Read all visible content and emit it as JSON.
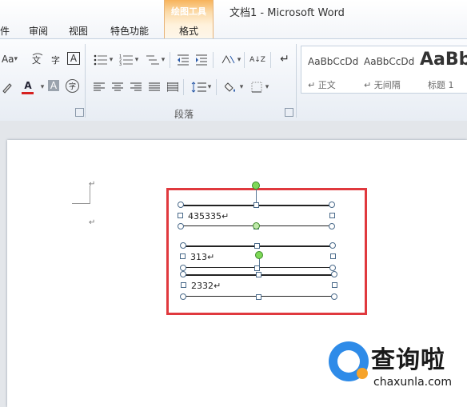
{
  "window": {
    "title": "文档1  -  Microsoft Word"
  },
  "tabs": {
    "file_partial": "件",
    "review": "审阅",
    "view": "视图",
    "special": "特色功能",
    "contextual_group": "绘图工具",
    "format": "格式"
  },
  "ribbon": {
    "font_partial": {
      "change_case_icon": "Aa",
      "font_color_letter": "A",
      "shade_letter": "A",
      "border_letter": "A"
    },
    "paragraph": {
      "group_label": "段落",
      "sort_label": "A↓Z"
    },
    "styles": {
      "items": [
        {
          "sample": "AaBbCcDd",
          "name": "↵ 正文"
        },
        {
          "sample": "AaBbCcDd",
          "name": "↵ 无间隔"
        },
        {
          "sample": "AaBb",
          "name": "标题 1"
        }
      ]
    },
    "colors": {
      "font_color_bar": "#d62020",
      "contextual_tab": "#f7b35a"
    }
  },
  "document": {
    "textboxes": [
      {
        "text": "435335↵"
      },
      {
        "text": "313↵"
      },
      {
        "text": "2332↵"
      }
    ],
    "para_mark": "↵",
    "highlight_color": "#e0393e"
  },
  "watermark": {
    "cn": "查询啦",
    "en": "chaxunla.com"
  }
}
